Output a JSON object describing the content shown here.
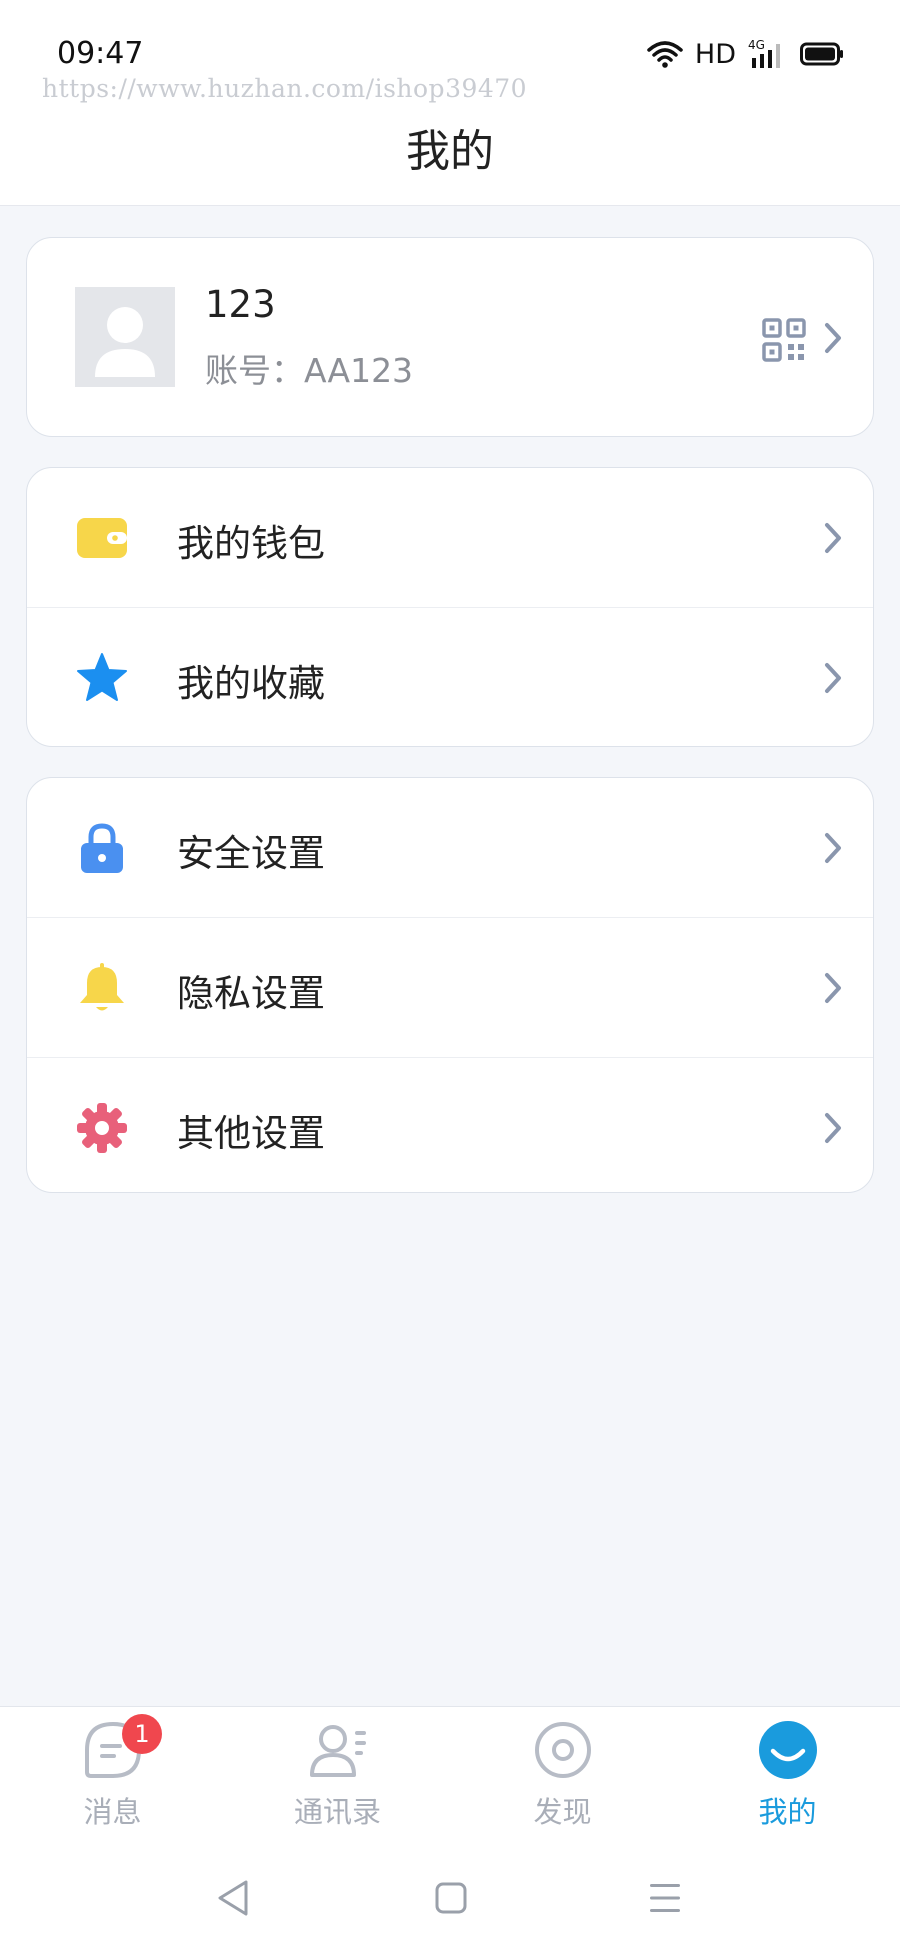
{
  "status_bar": {
    "time": "09:47",
    "network_label": "HD",
    "network_type": "4G"
  },
  "watermark": "https://www.huzhan.com/ishop39470",
  "header": {
    "title": "我的"
  },
  "profile": {
    "name": "123",
    "account": "账号：AA123",
    "avatar_icon": "user-avatar-icon",
    "qr_icon": "qr-code-icon"
  },
  "menu_groups": [
    [
      {
        "label": "我的钱包",
        "icon": "wallet-icon",
        "color": "#f7d64a"
      },
      {
        "label": "我的收藏",
        "icon": "star-icon",
        "color": "#1b8ff0"
      }
    ],
    [
      {
        "label": "安全设置",
        "icon": "lock-icon",
        "color": "#4a90f0"
      },
      {
        "label": "隐私设置",
        "icon": "bell-icon",
        "color": "#f7d64a"
      },
      {
        "label": "其他设置",
        "icon": "gear-icon",
        "color": "#e8607a"
      }
    ]
  ],
  "tabs": [
    {
      "label": "消息",
      "badge": "1",
      "icon": "message-icon"
    },
    {
      "label": "通讯录",
      "icon": "contacts-icon"
    },
    {
      "label": "发现",
      "icon": "discover-icon"
    },
    {
      "label": "我的",
      "icon": "me-icon",
      "active": true
    }
  ],
  "colors": {
    "accent": "#1a9bdd",
    "badge": "#f0474e",
    "inactive_tab": "#a9aeb8",
    "chevron": "#8a96ad",
    "page_background": "#f4f6fa"
  }
}
